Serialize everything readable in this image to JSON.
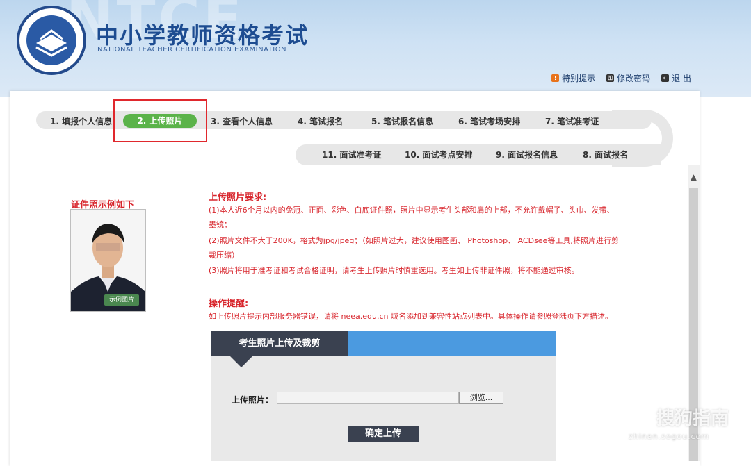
{
  "header": {
    "ghost_text": "NTCE",
    "title": "中小学教师资格考试",
    "subtitle": "NATIONAL TEACHER CERTIFICATION EXAMINATION",
    "links": [
      {
        "label": "特别提示",
        "icon": "notice-icon",
        "color": "#e8731c"
      },
      {
        "label": "修改密码",
        "icon": "key-icon",
        "color": "#333333"
      },
      {
        "label": "退 出",
        "icon": "logout-icon",
        "color": "#333333"
      }
    ]
  },
  "nav": {
    "top": [
      "1. 填报个人信息",
      "2. 上传照片",
      "3. 查看个人信息",
      "4. 笔试报名",
      "5. 笔试报名信息",
      "6. 笔试考场安排",
      "7. 笔试准考证"
    ],
    "bottom": [
      "11. 面试准考证",
      "10. 面试考点安排",
      "9. 面试报名信息",
      "8. 面试报名"
    ],
    "active_index": 1,
    "active_color": "#5bb34a"
  },
  "sample": {
    "label": "证件照示例如下",
    "badge": "示例图片"
  },
  "requirements": {
    "title": "上传照片要求:",
    "lines": [
      "(1)本人近6个月以内的免冠、正面、彩色、白底证件照，照片中显示考生头部和肩的上部，不允许戴帽子、头巾、发带、",
      "墨镜；",
      "(2)照片文件不大于200K，格式为jpg/jpeg；（如照片过大，建议使用图画、 Photoshop、 ACDsee等工具,将照片进行剪",
      "裁压缩）",
      "(3)照片将用于准考证和考试合格证明，请考生上传照片时慎重选用。考生如上传非证件照，将不能通过审核。"
    ]
  },
  "tips": {
    "title": "操作提醒:",
    "text": "如上传照片提示内部服务器错误，请将 neea.edu.cn 域名添加到兼容性站点列表中。具体操作请参照登陆页下方描述。"
  },
  "upload": {
    "tab_label": "考生照片上传及裁剪",
    "field_label": "上传照片：",
    "file_value": "",
    "browse_label": "浏览...",
    "submit_label": "确定上传"
  },
  "watermark": {
    "text": "搜狗指南",
    "url": "zhinan.sogou.com"
  },
  "colors": {
    "accent_red": "#d8262d",
    "panel_dark": "#3a4150",
    "panel_blue": "#4b9ae0"
  }
}
